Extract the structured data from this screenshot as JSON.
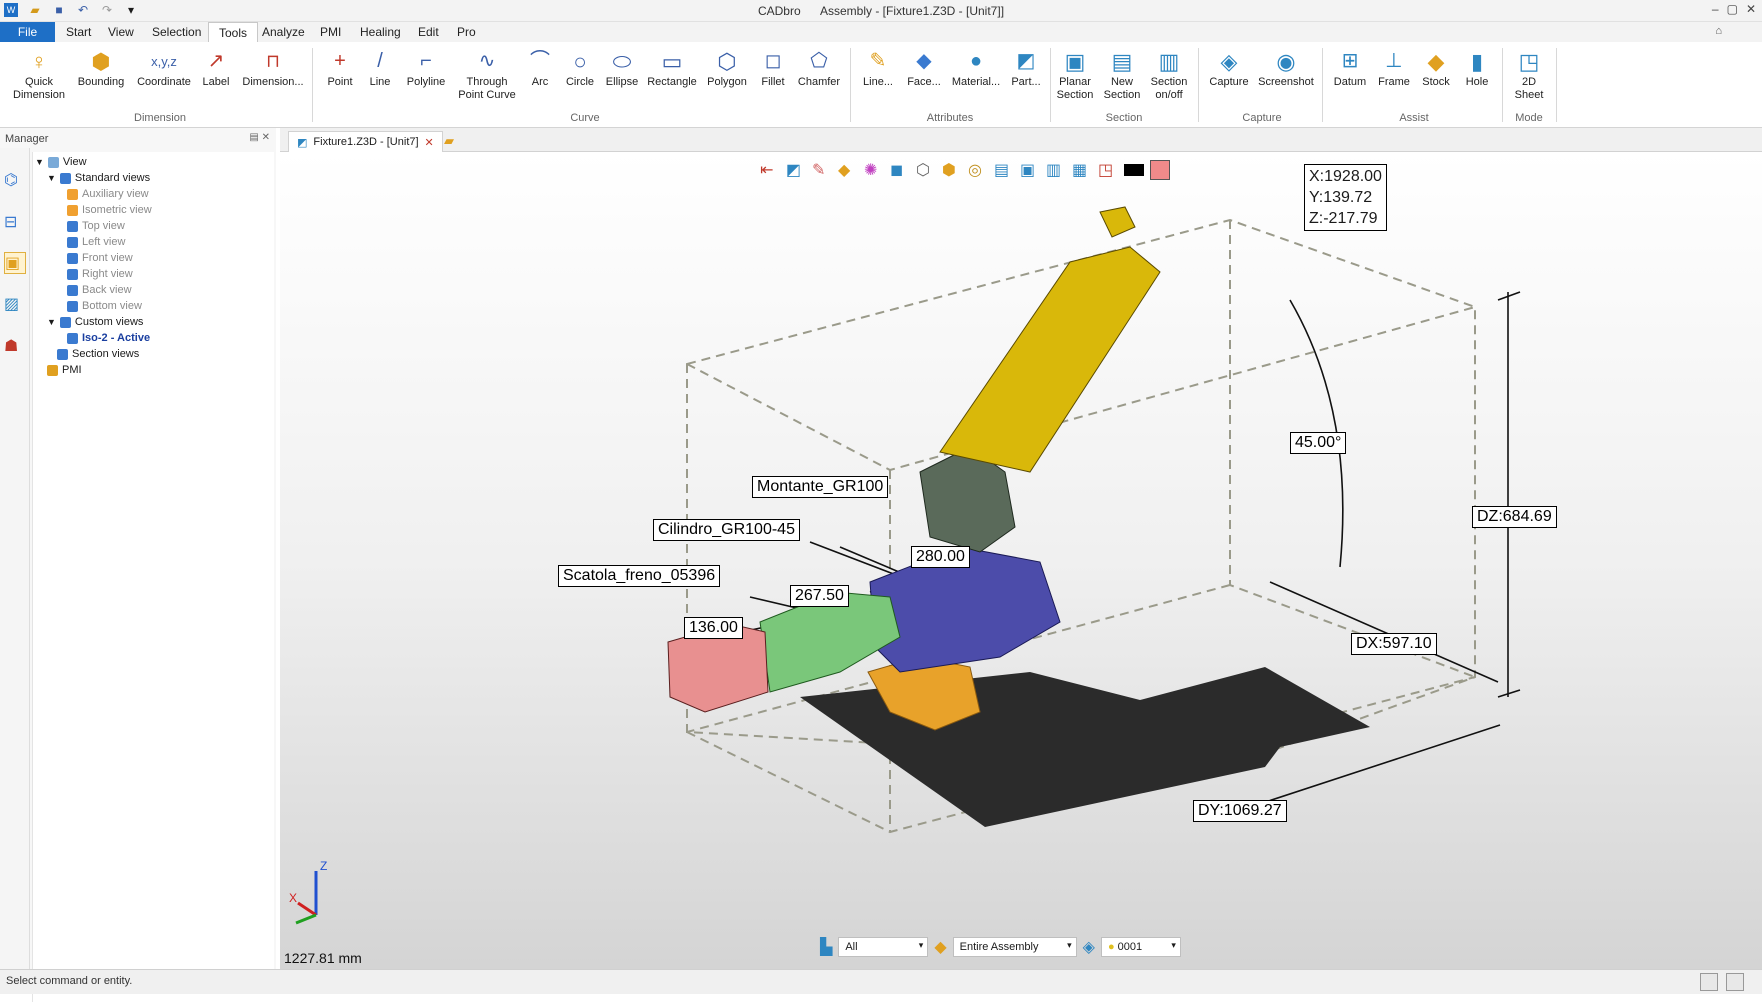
{
  "window": {
    "app": "CADbro",
    "title": "Assembly - [Fixture1.Z3D - [Unit7]]"
  },
  "menu": {
    "file": "File",
    "items": [
      "Start",
      "View",
      "Selection",
      "Tools",
      "Analyze",
      "PMI",
      "Healing",
      "Edit",
      "Pro"
    ],
    "active": "Tools"
  },
  "ribbon": {
    "buttons": [
      {
        "l1": "Quick",
        "l2": "Dimension"
      },
      {
        "l1": "Bounding",
        "l2": ""
      },
      {
        "l1": "Coordinate",
        "l2": ""
      },
      {
        "l1": "Label",
        "l2": ""
      },
      {
        "l1": "Dimension...",
        "l2": ""
      },
      {
        "l1": "Point",
        "l2": ""
      },
      {
        "l1": "Line",
        "l2": ""
      },
      {
        "l1": "Polyline",
        "l2": ""
      },
      {
        "l1": "Through",
        "l2": "Point Curve"
      },
      {
        "l1": "Arc",
        "l2": ""
      },
      {
        "l1": "Circle",
        "l2": ""
      },
      {
        "l1": "Ellipse",
        "l2": ""
      },
      {
        "l1": "Rectangle",
        "l2": ""
      },
      {
        "l1": "Polygon",
        "l2": ""
      },
      {
        "l1": "Fillet",
        "l2": ""
      },
      {
        "l1": "Chamfer",
        "l2": ""
      },
      {
        "l1": "Line...",
        "l2": ""
      },
      {
        "l1": "Face...",
        "l2": ""
      },
      {
        "l1": "Material...",
        "l2": ""
      },
      {
        "l1": "Part...",
        "l2": ""
      },
      {
        "l1": "Planar",
        "l2": "Section"
      },
      {
        "l1": "New",
        "l2": "Section"
      },
      {
        "l1": "Section",
        "l2": "on/off"
      },
      {
        "l1": "Capture",
        "l2": ""
      },
      {
        "l1": "Screenshot",
        "l2": ""
      },
      {
        "l1": "Datum",
        "l2": ""
      },
      {
        "l1": "Frame",
        "l2": ""
      },
      {
        "l1": "Stock",
        "l2": ""
      },
      {
        "l1": "Hole",
        "l2": ""
      },
      {
        "l1": "2D",
        "l2": "Sheet"
      }
    ],
    "groups": [
      "Dimension",
      "Curve",
      "Attributes",
      "Section",
      "Capture",
      "Assist",
      "Mode"
    ]
  },
  "manager": {
    "title": "Manager",
    "tree": [
      {
        "label": "View"
      },
      {
        "label": "Standard views"
      },
      {
        "label": "Auxiliary view"
      },
      {
        "label": "Isometric view"
      },
      {
        "label": "Top view"
      },
      {
        "label": "Left view"
      },
      {
        "label": "Front view"
      },
      {
        "label": "Right view"
      },
      {
        "label": "Back view"
      },
      {
        "label": "Bottom view"
      },
      {
        "label": "Custom views"
      },
      {
        "label": "Iso-2 - Active"
      },
      {
        "label": "Section views"
      },
      {
        "label": "PMI"
      }
    ]
  },
  "tab": {
    "label": "Fixture1.Z3D - [Unit7]"
  },
  "viewport": {
    "coords": {
      "x": "X:1928.00",
      "y": "Y:139.72",
      "z": "Z:-217.79"
    },
    "labels": {
      "angle": "45.00°",
      "dz": "DZ:684.69",
      "dx": "DX:597.10",
      "dy": "DY:1069.27",
      "montante": "Montante_GR100",
      "cilindro": "Cilindro_GR100-45",
      "scatola": "Scatola_freno_05396",
      "d280": "280.00",
      "d267": "267.50",
      "d136": "136.00"
    },
    "scale": "1227.81 mm",
    "axes": {
      "x": "X",
      "z": "Z"
    }
  },
  "filters": {
    "type": "All",
    "scope": "Entire Assembly",
    "layer": "0001"
  },
  "status": "Select command or entity.",
  "colors": {
    "accent": "#1e6fc6",
    "arm": "#d9b80a",
    "base": "#2b2b2b",
    "block": "#4c4caa",
    "cyl": "#7ac77a",
    "brake": "#e89090",
    "support": "#e8a22a",
    "joint": "#5a6a5a"
  }
}
